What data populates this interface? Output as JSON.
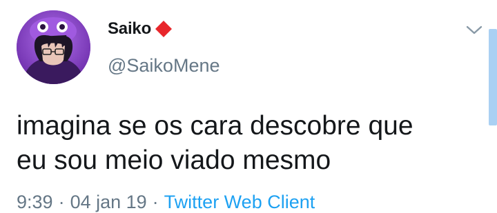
{
  "author": {
    "display_name": "Saiko",
    "handle": "@SaikoMene",
    "name_emoji": "red-diamond-icon"
  },
  "tweet": {
    "line1": "imagina se os cara descobre que",
    "line2": "eu sou meio viado mesmo"
  },
  "meta": {
    "time": "9:39",
    "date": "04 jan 19",
    "separator": "·",
    "client": "Twitter Web Client"
  },
  "colors": {
    "text": "#14171a",
    "secondary": "#657786",
    "link": "#1da1f2",
    "diamond": "#e8262b",
    "avatar_bg": "#8a45c9"
  }
}
